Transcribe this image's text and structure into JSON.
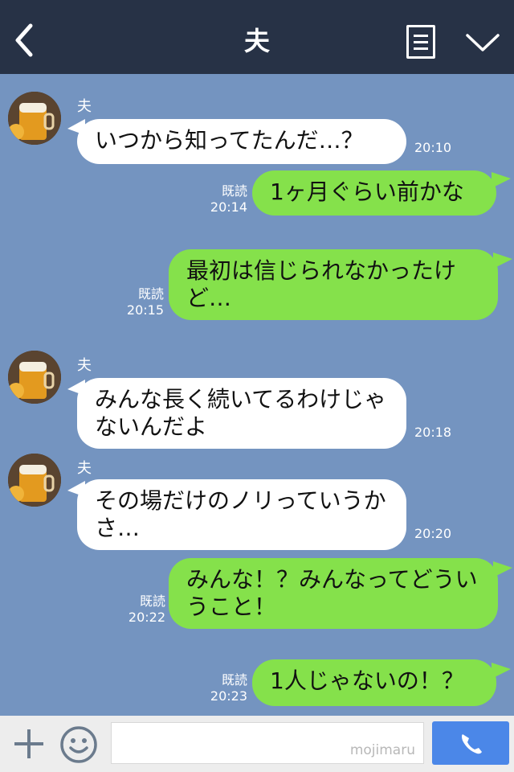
{
  "header": {
    "title": "夫",
    "back_icon": "chevron-left-icon",
    "menu_icon": "list-icon",
    "dropdown_icon": "chevron-down-icon"
  },
  "messages": [
    {
      "direction": "incoming",
      "sender": "夫",
      "text": "いつから知ってたんだ…？",
      "time": "20:10"
    },
    {
      "direction": "outgoing",
      "read_label": "既読",
      "text": "1ヶ月ぐらい前かな",
      "time": "20:14"
    },
    {
      "direction": "outgoing",
      "read_label": "既読",
      "text": "最初は信じられなかったけど…",
      "time": "20:15"
    },
    {
      "direction": "incoming",
      "sender": "夫",
      "text": "みんな長く続いてるわけじゃないんだよ",
      "time": "20:18"
    },
    {
      "direction": "incoming",
      "sender": "夫",
      "text": "その場だけのノリっていうかさ…",
      "time": "20:20"
    },
    {
      "direction": "outgoing",
      "read_label": "既読",
      "text": "みんな！？みんなってどういうこと！",
      "time": "20:22"
    },
    {
      "direction": "outgoing",
      "read_label": "既読",
      "text": "1人じゃないの！？",
      "time": "20:23"
    }
  ],
  "footer": {
    "plus_icon": "plus-icon",
    "emoji_icon": "smiley-icon",
    "input_value": "",
    "watermark": "mojimaru",
    "call_icon": "phone-icon"
  },
  "colors": {
    "header_bg": "#273246",
    "chat_bg": "#7494c0",
    "incoming_bubble": "#ffffff",
    "outgoing_bubble": "#85e14b",
    "call_button": "#4b87e8"
  }
}
